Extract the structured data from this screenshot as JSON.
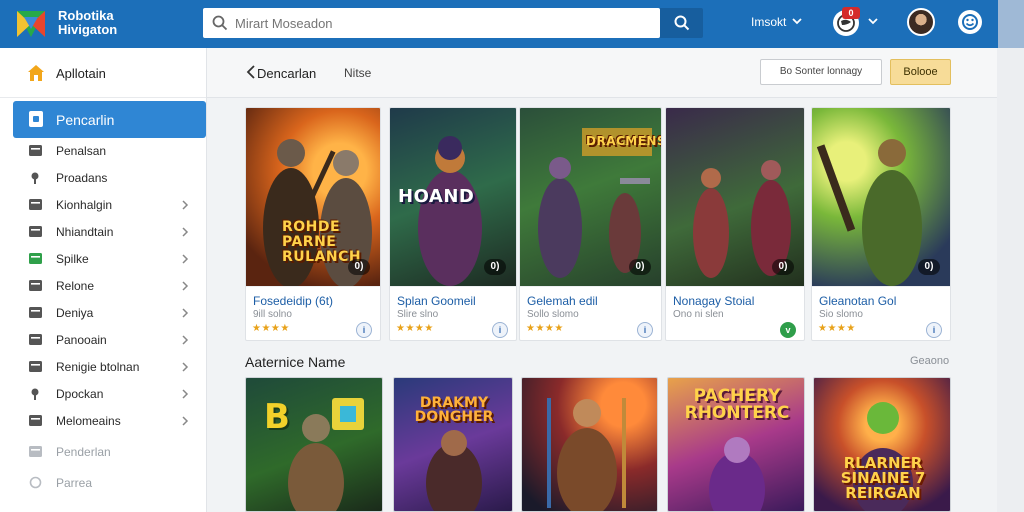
{
  "app": {
    "brand_line1": "Robotika",
    "brand_line2": "Hivigaton"
  },
  "search": {
    "placeholder": "Mirart Moseadon"
  },
  "header": {
    "language": "Imsokt",
    "notification_count": "0"
  },
  "sidebar": {
    "home_label": "Apllotain",
    "active_label": "Pencarlin",
    "items": [
      {
        "label": "Penalsan",
        "has_chevron": false,
        "muted": false
      },
      {
        "label": "Proadans",
        "has_chevron": false,
        "muted": false
      },
      {
        "label": "Kionhalgin",
        "has_chevron": true,
        "muted": false
      },
      {
        "label": "Nhiandtain",
        "has_chevron": true,
        "muted": false
      },
      {
        "label": "Spilke",
        "has_chevron": true,
        "muted": false
      },
      {
        "label": "Relone",
        "has_chevron": true,
        "muted": false
      },
      {
        "label": "Deniya",
        "has_chevron": true,
        "muted": false
      },
      {
        "label": "Panooain",
        "has_chevron": true,
        "muted": false
      },
      {
        "label": "Renigie btolnan",
        "has_chevron": true,
        "muted": false
      },
      {
        "label": "Dpockan",
        "has_chevron": true,
        "muted": false
      },
      {
        "label": "Melomeains",
        "has_chevron": true,
        "muted": false
      },
      {
        "label": "Penderlan",
        "has_chevron": false,
        "muted": true
      },
      {
        "label": "Parrea",
        "has_chevron": false,
        "muted": true
      }
    ]
  },
  "main": {
    "breadcrumb_back": "Dencarlan",
    "breadcrumb_current": "Nitse",
    "filter_button": "Bo Sonter lonnagy",
    "primary_button": "Bolooe",
    "featured": [
      {
        "art_title": "ROHDE PARNE RULANCH",
        "video_badge": "0)",
        "title": "Fosedeidip (6t)",
        "subtitle": "9ill solno",
        "stars": "★★★★",
        "badge": "i",
        "badge_green": false
      },
      {
        "art_title": "HOAND",
        "art_title_2": "DRACMENS",
        "video_badge": "0)",
        "title": "Splan Goomeil",
        "subtitle": "Slire slno",
        "stars": "★★★★",
        "badge": "i",
        "badge_green": false
      },
      {
        "art_title": "",
        "video_badge": "0)",
        "title": "Gelemah edil",
        "subtitle": "Sollo slomo",
        "stars": "★★★★",
        "badge": "i",
        "badge_green": false
      },
      {
        "art_title": "",
        "video_badge": "0)",
        "title": "Nonagay Stoial",
        "subtitle": "Ono ni slen",
        "stars": "",
        "badge": "v",
        "badge_green": true
      },
      {
        "art_title": "",
        "video_badge": "0)",
        "title": "Gleanotan Gol",
        "subtitle": "Sio slomo",
        "stars": "★★★★",
        "badge": "i",
        "badge_green": false
      }
    ],
    "section_title": "Aaternice Name",
    "section_more": "Geaono",
    "tiles": [
      {
        "title": "B"
      },
      {
        "title": "DRAKMY DONGHER"
      },
      {
        "title": ""
      },
      {
        "title": "PACHERY RHONTERC"
      },
      {
        "title": "RLARNER SINAINE 7 REIRGAN"
      }
    ]
  },
  "colors": {
    "topbar": "#1c6fb9",
    "sidebar_active": "#2f86d4",
    "primary_button": "#f7dc98",
    "link_title": "#1d5ea6",
    "star": "#e8a21a"
  }
}
